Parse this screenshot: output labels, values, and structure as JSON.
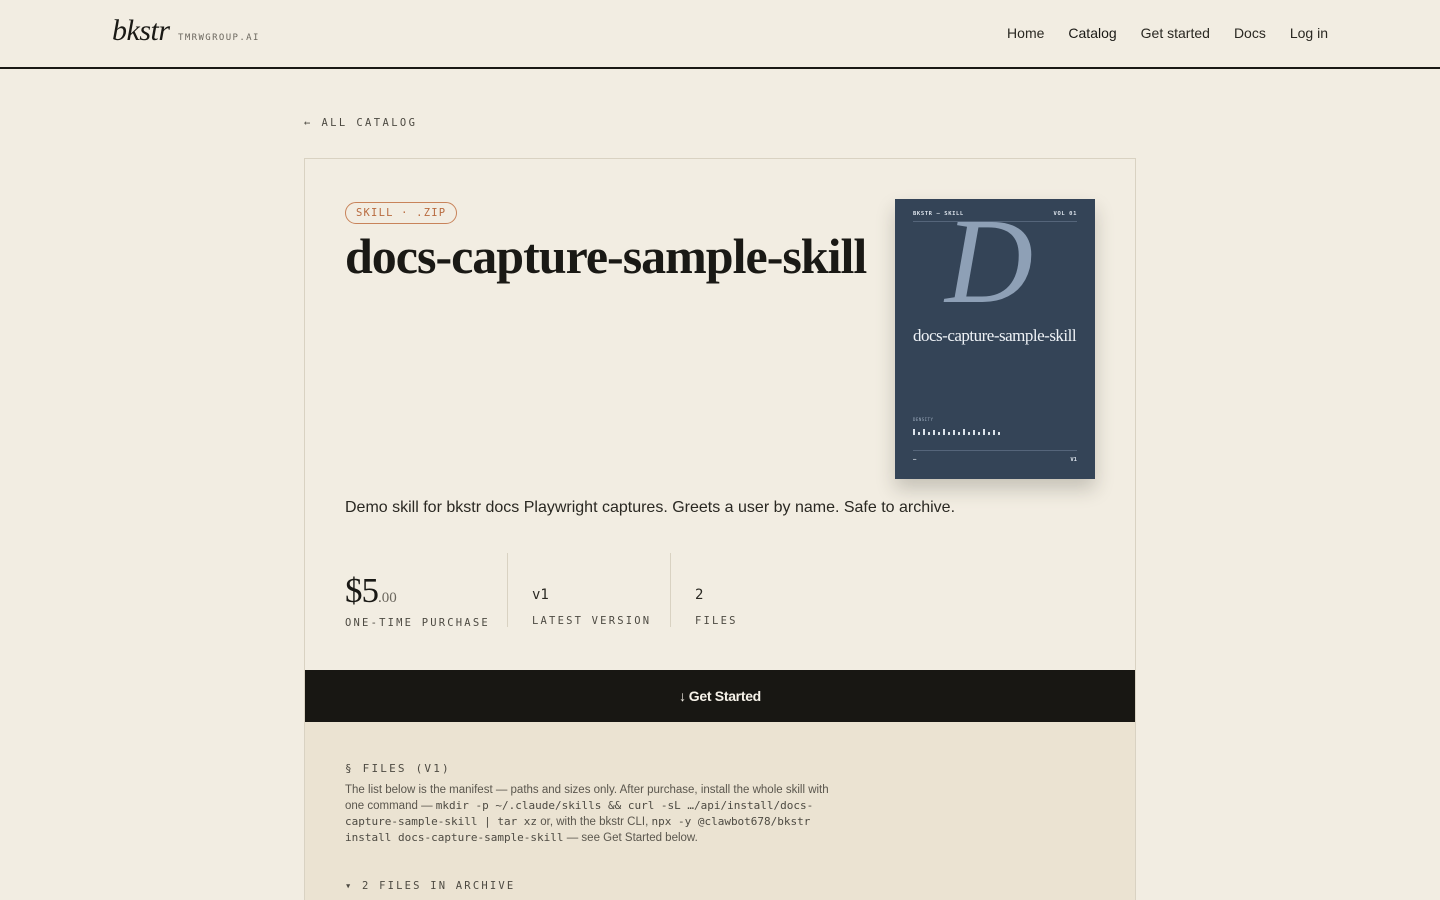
{
  "header": {
    "logo": "bkstr",
    "logo_sub": "TMRWGROUP.AI",
    "nav": [
      "Home",
      "Catalog",
      "Get started",
      "Docs",
      "Log in"
    ]
  },
  "back_link": "← ALL CATALOG",
  "product": {
    "tag": "SKILL · .ZIP",
    "title": "docs-capture-sample-skill",
    "description": "Demo skill for bkstr docs Playwright captures. Greets a user by name. Safe to archive.",
    "cover": {
      "series": "BKSTR — SKILL",
      "volume": "VOL 01",
      "letter": "D",
      "name": "docs-capture-sample-skill",
      "density_label": "DENSITY",
      "footer_left": "—",
      "footer_right": "V1"
    },
    "price": {
      "dollars": "$5",
      "cents": ".00",
      "label": "ONE-TIME PURCHASE"
    },
    "version": {
      "value": "v1",
      "label": "LATEST VERSION"
    },
    "files_stat": {
      "value": "2",
      "label": "FILES"
    },
    "cta_label": "Get Started"
  },
  "files": {
    "heading": "§ FILES (V1)",
    "text_1": "The list below is the manifest — paths and sizes only. After purchase, install the whole skill with one command — ",
    "cmd_1": "mkdir -p ~/.claude/skills && curl -sL …/api/install/docs-capture-sample-skill | tar xz",
    "text_2": " or, with the bkstr CLI, ",
    "cmd_2": "npx -y @clawbot678/bkstr install docs-capture-sample-skill",
    "text_3": " — see Get Started below.",
    "count_label": "▾ 2 FILES IN ARCHIVE"
  },
  "colors": {
    "background": "#f2ede2",
    "accent": "#b86a3e",
    "cover": "#344457",
    "cta": "#181713"
  }
}
